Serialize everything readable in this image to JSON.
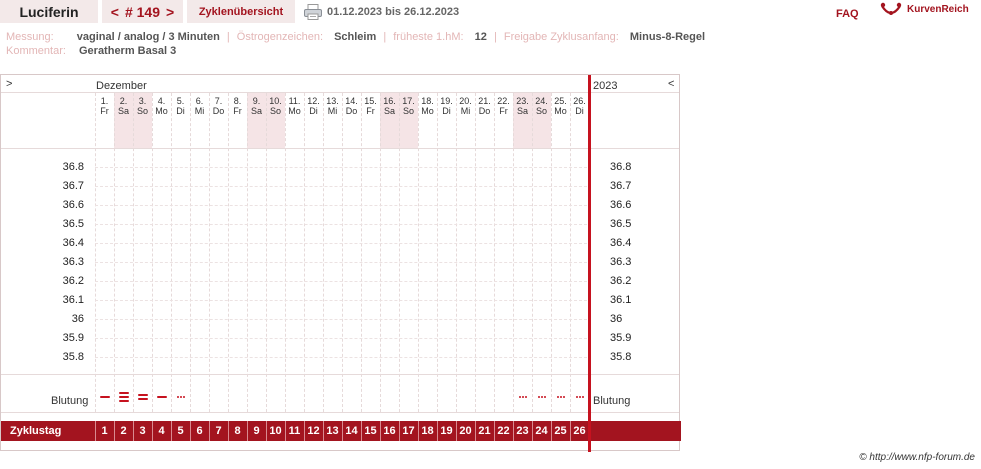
{
  "header": {
    "user": "Luciferin",
    "nav": {
      "prev": "<",
      "cycle": "# 149",
      "next": ">"
    },
    "overview": "Zyklenübersicht",
    "range": "01.12.2023 bis 26.12.2023",
    "faq": "FAQ",
    "brand": "KurvenReich"
  },
  "meta": {
    "messung_label": "Messung:",
    "messung_value": "vaginal / analog / 3 Minuten",
    "oestrogen_label": "Östrogenzeichen:",
    "oestrogen_value": "Schleim",
    "fhm_label": "früheste 1.hM:",
    "fhm_value": "12",
    "freigabe_label": "Freigabe Zyklusanfang:",
    "freigabe_value": "Minus-8-Regel",
    "kommentar_label": "Kommentar:",
    "kommentar_value": "Geratherm Basal 3"
  },
  "chart_data": {
    "type": "line",
    "left_arrow": ">",
    "right_arrow": "<",
    "month": "Dezember",
    "year": "2023",
    "days": [
      {
        "n": "1.",
        "d": "Fr"
      },
      {
        "n": "2.",
        "d": "Sa"
      },
      {
        "n": "3.",
        "d": "So"
      },
      {
        "n": "4.",
        "d": "Mo"
      },
      {
        "n": "5.",
        "d": "Di"
      },
      {
        "n": "6.",
        "d": "Mi"
      },
      {
        "n": "7.",
        "d": "Do"
      },
      {
        "n": "8.",
        "d": "Fr"
      },
      {
        "n": "9.",
        "d": "Sa"
      },
      {
        "n": "10.",
        "d": "So"
      },
      {
        "n": "11.",
        "d": "Mo"
      },
      {
        "n": "12.",
        "d": "Di"
      },
      {
        "n": "13.",
        "d": "Mi"
      },
      {
        "n": "14.",
        "d": "Do"
      },
      {
        "n": "15.",
        "d": "Fr"
      },
      {
        "n": "16.",
        "d": "Sa"
      },
      {
        "n": "17.",
        "d": "So"
      },
      {
        "n": "18.",
        "d": "Mo"
      },
      {
        "n": "19.",
        "d": "Di"
      },
      {
        "n": "20.",
        "d": "Mi"
      },
      {
        "n": "21.",
        "d": "Do"
      },
      {
        "n": "22.",
        "d": "Fr"
      },
      {
        "n": "23.",
        "d": "Sa"
      },
      {
        "n": "24.",
        "d": "So"
      },
      {
        "n": "25.",
        "d": "Mo"
      },
      {
        "n": "26.",
        "d": "Di"
      }
    ],
    "weekend_days": [
      2,
      3,
      9,
      10,
      16,
      17,
      23,
      24
    ],
    "y_ticks": [
      "36.8",
      "36.7",
      "36.6",
      "36.5",
      "36.4",
      "36.3",
      "36.2",
      "36.1",
      "36",
      "35.9",
      "35.8"
    ],
    "temperatures": [],
    "bleeding_label": "Blutung",
    "bleeding": [
      {
        "day": 1,
        "type": "medium"
      },
      {
        "day": 2,
        "type": "heavy"
      },
      {
        "day": 3,
        "type": "strong"
      },
      {
        "day": 4,
        "type": "medium"
      },
      {
        "day": 5,
        "type": "spotting"
      },
      {
        "day": 23,
        "type": "spotting"
      },
      {
        "day": 24,
        "type": "spotting"
      },
      {
        "day": 25,
        "type": "spotting"
      },
      {
        "day": 26,
        "type": "spotting"
      }
    ],
    "cycle_label": "Zyklustag",
    "cycle_days": [
      1,
      2,
      3,
      4,
      5,
      6,
      7,
      8,
      9,
      10,
      11,
      12,
      13,
      14,
      15,
      16,
      17,
      18,
      19,
      20,
      21,
      22,
      23,
      24,
      25,
      26
    ],
    "colors": {
      "accent": "#a3141f",
      "weekend": "#f5e4e6",
      "bleeding": "#c6121f"
    }
  },
  "footer": {
    "copyright": "© http://www.nfp-forum.de"
  }
}
